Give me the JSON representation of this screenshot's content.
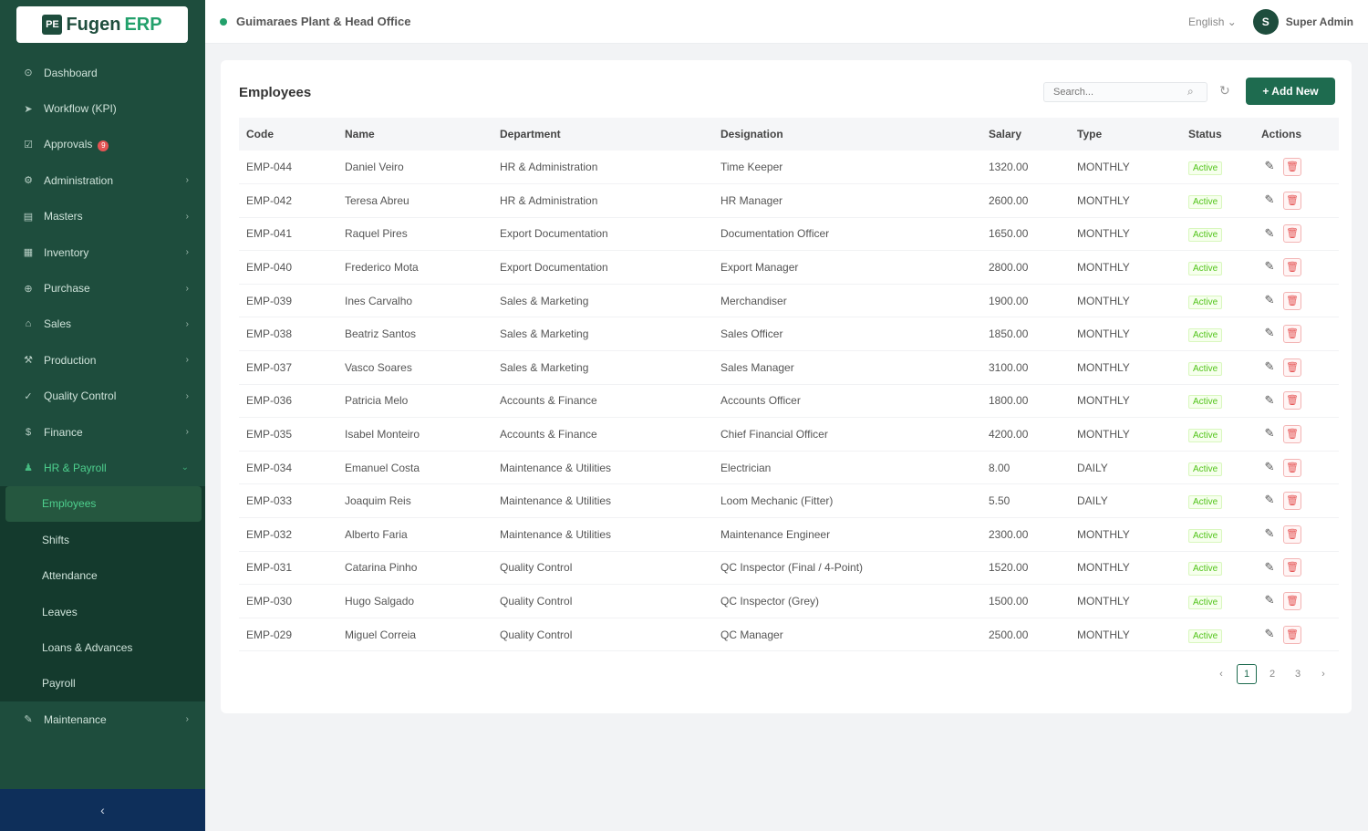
{
  "logo": {
    "mark": "PE",
    "text": "Fugen",
    "accent": "ERP"
  },
  "sidebar": {
    "items": [
      {
        "label": "Dashboard",
        "icon": "dashboard-icon",
        "glyph": "⊙",
        "chev": ""
      },
      {
        "label": "Workflow (KPI)",
        "icon": "workflow-icon",
        "glyph": "➤",
        "chev": ""
      },
      {
        "label": "Approvals",
        "icon": "approvals-icon",
        "glyph": "☑",
        "chev": "",
        "badge": "9"
      },
      {
        "label": "Administration",
        "icon": "admin-icon",
        "glyph": "⚙",
        "chev": "›"
      },
      {
        "label": "Masters",
        "icon": "masters-icon",
        "glyph": "▤",
        "chev": "›"
      },
      {
        "label": "Inventory",
        "icon": "inventory-icon",
        "glyph": "▦",
        "chev": "›"
      },
      {
        "label": "Purchase",
        "icon": "purchase-icon",
        "glyph": "⊕",
        "chev": "›"
      },
      {
        "label": "Sales",
        "icon": "sales-icon",
        "glyph": "⌂",
        "chev": "›"
      },
      {
        "label": "Production",
        "icon": "production-icon",
        "glyph": "⚒",
        "chev": "›"
      },
      {
        "label": "Quality Control",
        "icon": "quality-icon",
        "glyph": "✓",
        "chev": "›"
      },
      {
        "label": "Finance",
        "icon": "finance-icon",
        "glyph": "$",
        "chev": "›"
      },
      {
        "label": "HR & Payroll",
        "icon": "hr-icon",
        "glyph": "♟",
        "chev": "⌄"
      }
    ],
    "hr_sub": [
      "Employees",
      "Shifts",
      "Attendance",
      "Leaves",
      "Loans & Advances",
      "Payroll"
    ],
    "bottom_item": {
      "label": "Maintenance",
      "icon": "maintenance-icon",
      "glyph": "✎",
      "chev": "›"
    },
    "collapse_glyph": "‹"
  },
  "header": {
    "location": "Guimaraes Plant & Head Office",
    "language": "English ⌄",
    "avatar_initial": "S",
    "user": "Super Admin"
  },
  "page": {
    "title": "Employees",
    "search_placeholder": "Search...",
    "add_label": "+ Add New"
  },
  "table": {
    "headers": [
      "Code",
      "Name",
      "Department",
      "Designation",
      "Salary",
      "Type",
      "Status",
      "Actions"
    ],
    "rows": [
      [
        "EMP-044",
        "Daniel Veiro",
        "HR & Administration",
        "Time Keeper",
        "1320.00",
        "MONTHLY",
        "Active"
      ],
      [
        "EMP-042",
        "Teresa Abreu",
        "HR & Administration",
        "HR Manager",
        "2600.00",
        "MONTHLY",
        "Active"
      ],
      [
        "EMP-041",
        "Raquel Pires",
        "Export Documentation",
        "Documentation Officer",
        "1650.00",
        "MONTHLY",
        "Active"
      ],
      [
        "EMP-040",
        "Frederico Mota",
        "Export Documentation",
        "Export Manager",
        "2800.00",
        "MONTHLY",
        "Active"
      ],
      [
        "EMP-039",
        "Ines Carvalho",
        "Sales & Marketing",
        "Merchandiser",
        "1900.00",
        "MONTHLY",
        "Active"
      ],
      [
        "EMP-038",
        "Beatriz Santos",
        "Sales & Marketing",
        "Sales Officer",
        "1850.00",
        "MONTHLY",
        "Active"
      ],
      [
        "EMP-037",
        "Vasco Soares",
        "Sales & Marketing",
        "Sales Manager",
        "3100.00",
        "MONTHLY",
        "Active"
      ],
      [
        "EMP-036",
        "Patricia Melo",
        "Accounts & Finance",
        "Accounts Officer",
        "1800.00",
        "MONTHLY",
        "Active"
      ],
      [
        "EMP-035",
        "Isabel Monteiro",
        "Accounts & Finance",
        "Chief Financial Officer",
        "4200.00",
        "MONTHLY",
        "Active"
      ],
      [
        "EMP-034",
        "Emanuel Costa",
        "Maintenance & Utilities",
        "Electrician",
        "8.00",
        "DAILY",
        "Active"
      ],
      [
        "EMP-033",
        "Joaquim Reis",
        "Maintenance & Utilities",
        "Loom Mechanic (Fitter)",
        "5.50",
        "DAILY",
        "Active"
      ],
      [
        "EMP-032",
        "Alberto Faria",
        "Maintenance & Utilities",
        "Maintenance Engineer",
        "2300.00",
        "MONTHLY",
        "Active"
      ],
      [
        "EMP-031",
        "Catarina Pinho",
        "Quality Control",
        "QC Inspector (Final / 4-Point)",
        "1520.00",
        "MONTHLY",
        "Active"
      ],
      [
        "EMP-030",
        "Hugo Salgado",
        "Quality Control",
        "QC Inspector (Grey)",
        "1500.00",
        "MONTHLY",
        "Active"
      ],
      [
        "EMP-029",
        "Miguel Correia",
        "Quality Control",
        "QC Manager",
        "2500.00",
        "MONTHLY",
        "Active"
      ]
    ]
  },
  "pagination": {
    "prev": "‹",
    "pages": [
      "1",
      "2",
      "3"
    ],
    "next": "›",
    "active": "1"
  },
  "colors": {
    "sidebar": "#1e4d3d",
    "accent": "#22a06b",
    "primary_button": "#1e6b4f",
    "danger": "#e55353",
    "status_active": "#52c41a"
  }
}
